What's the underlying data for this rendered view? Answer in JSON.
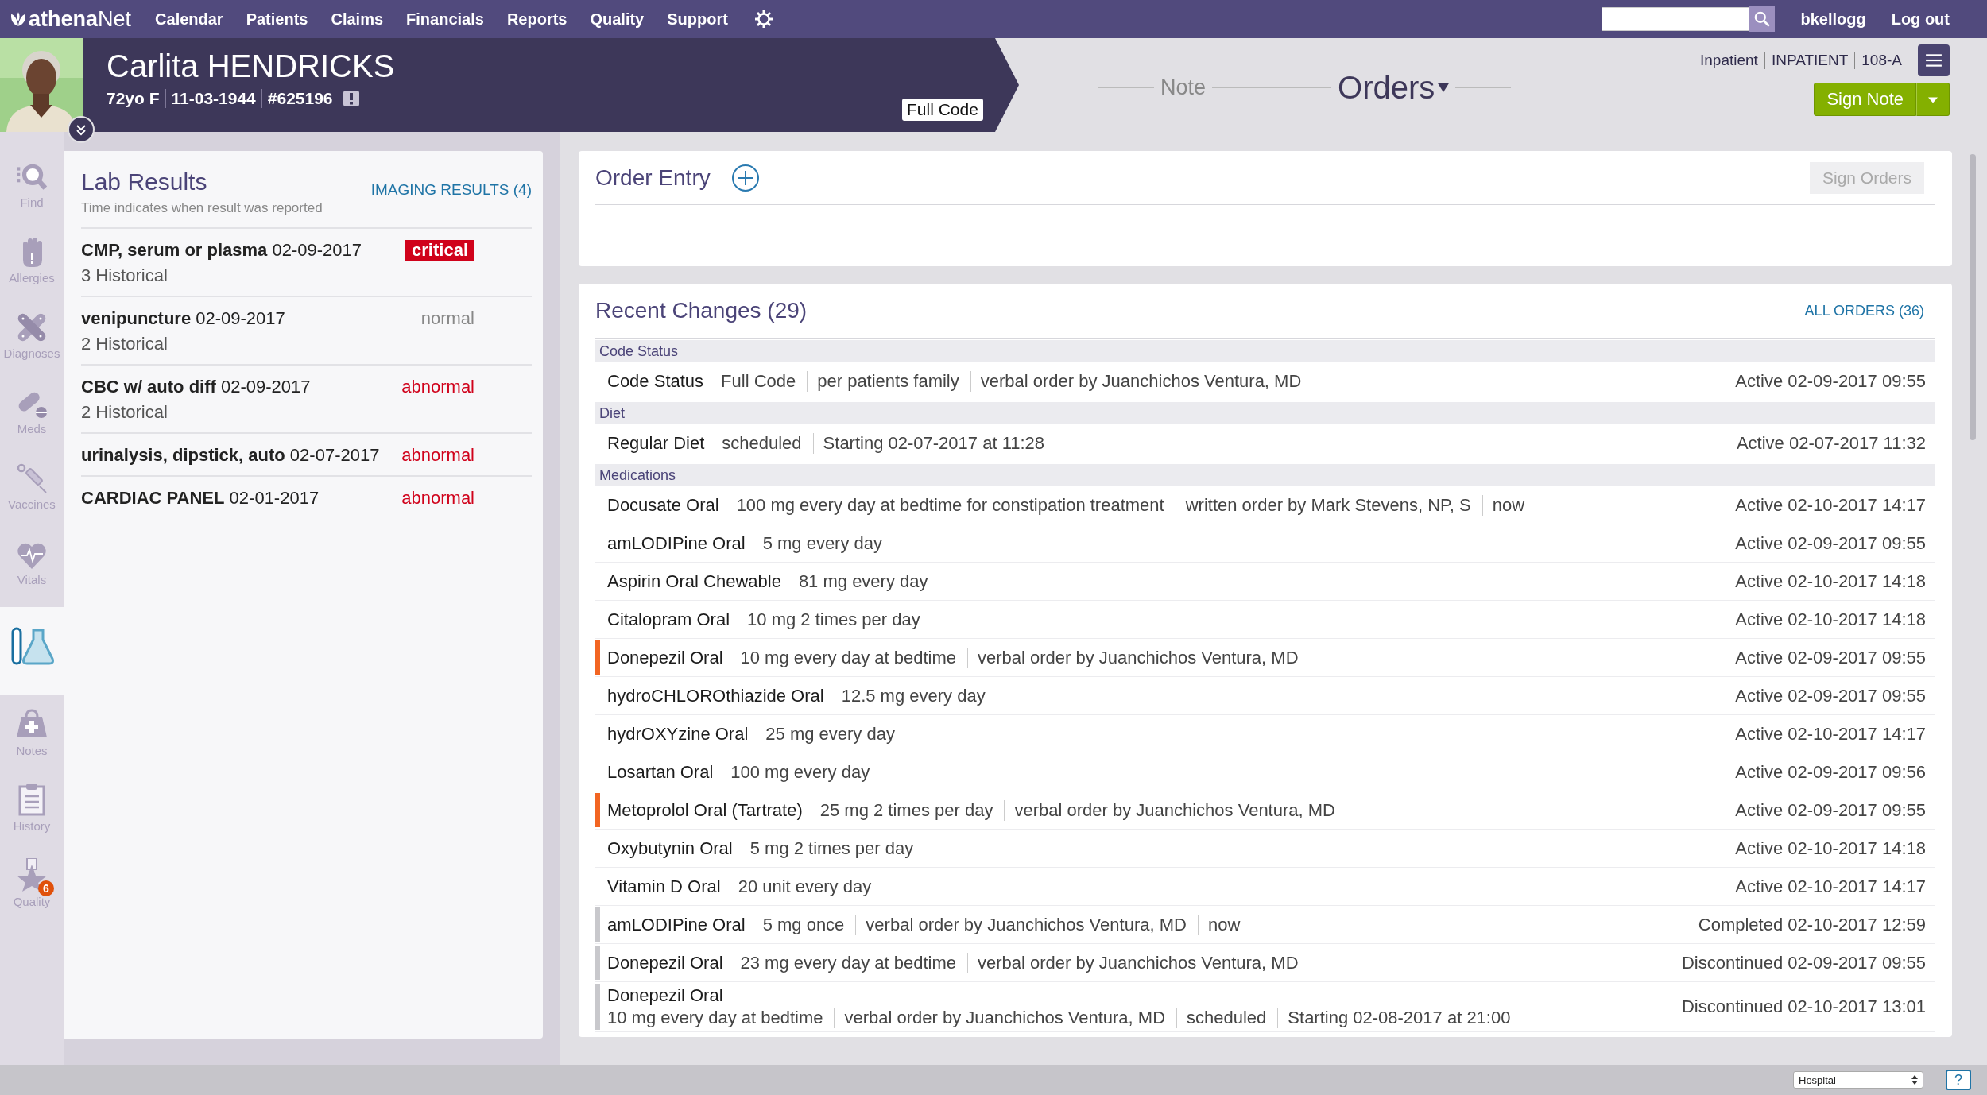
{
  "top_nav": {
    "logo": "**athena**Net",
    "items": [
      "Calendar",
      "Patients",
      "Claims",
      "Financials",
      "Reports",
      "Quality",
      "Support"
    ],
    "user": "bkellogg",
    "logout": "Log out"
  },
  "patient": {
    "name": "Carlita HENDRICKS",
    "age_sex": "72yo F",
    "dob": "11-03-1944",
    "id": "#625196",
    "code_status": "Full Code"
  },
  "encounter": [
    "Inpatient",
    "INPATIENT",
    "108-A"
  ],
  "workflow": [
    {
      "label": "Note",
      "selected": false
    },
    {
      "label": "Orders",
      "selected": true
    }
  ],
  "sign_note": "Sign Note",
  "sidebar": [
    {
      "kind": "find",
      "label": "Find",
      "selected": false
    },
    {
      "kind": "allergies",
      "label": "Allergies",
      "selected": false
    },
    {
      "kind": "diagnoses",
      "label": "Diagnoses",
      "selected": false
    },
    {
      "kind": "meds",
      "label": "Meds",
      "selected": false
    },
    {
      "kind": "vaccines",
      "label": "Vaccines",
      "selected": false
    },
    {
      "kind": "vitals",
      "label": "Vitals",
      "selected": false
    },
    {
      "kind": "labs",
      "selected": true
    },
    {
      "kind": "notes",
      "label": "Notes",
      "selected": false
    },
    {
      "kind": "history",
      "label": "History",
      "selected": false
    },
    {
      "kind": "quality",
      "label": "Quality",
      "selected": false,
      "badge": "6"
    }
  ],
  "lab_results": {
    "title": "Lab Results",
    "imaging_link": "IMAGING RESULTS (4)",
    "subtitle": "Time indicates when result was reported",
    "rows": [
      {
        "name": "CMP, serum or plasma",
        "date": "02-09-2017",
        "historical": "3 Historical",
        "status": "critical",
        "kind": "critical"
      },
      {
        "name": "venipuncture",
        "date": "02-09-2017",
        "historical": "2 Historical",
        "status": "normal",
        "kind": "normal"
      },
      {
        "name": "CBC w/ auto diff",
        "date": "02-09-2017",
        "historical": "2 Historical",
        "status": "abnormal",
        "kind": "abnormal"
      },
      {
        "name": "urinalysis, dipstick, auto",
        "date": "02-07-2017",
        "status": "abnormal",
        "kind": "abnormal"
      },
      {
        "name": "CARDIAC PANEL",
        "date": "02-01-2017",
        "status": "abnormal",
        "kind": "abnormal"
      }
    ]
  },
  "order_entry": {
    "title": "Order Entry",
    "sign_button": {
      "label": "Sign Orders",
      "disabled": true
    }
  },
  "recent_changes": {
    "title": "Recent Changes (29)",
    "all_orders": "ALL ORDERS (36)",
    "sections": [
      {
        "name": "Code Status",
        "rows": [
          {
            "name": "Code Status",
            "details": [
              "Full Code",
              "per patients family",
              "verbal order by Juanchichos Ventura, MD"
            ],
            "status": "Active 02-09-2017 09:55"
          }
        ]
      },
      {
        "name": "Diet",
        "rows": [
          {
            "name": "Regular Diet",
            "details": [
              "scheduled",
              "Starting 02-07-2017 at 11:28"
            ],
            "status": "Active 02-07-2017 11:32"
          }
        ]
      },
      {
        "name": "Medications",
        "rows": [
          {
            "name": "Docusate Oral",
            "details": [
              "100 mg every day at bedtime for constipation treatment",
              "written order by Mark Stevens, NP, S",
              "now"
            ],
            "status": "Active 02-10-2017 14:17"
          },
          {
            "name": "amLODIPine Oral",
            "details": [
              "5 mg every day"
            ],
            "status": "Active 02-09-2017 09:55"
          },
          {
            "name": "Aspirin Oral Chewable",
            "details": [
              "81 mg every day"
            ],
            "status": "Active 02-10-2017 14:18"
          },
          {
            "name": "Citalopram Oral",
            "details": [
              "10 mg 2 times per day"
            ],
            "status": "Active 02-10-2017 14:18"
          },
          {
            "name": "Donepezil Oral",
            "details": [
              "10 mg every day at bedtime",
              "verbal order by Juanchichos Ventura, MD"
            ],
            "status": "Active 02-09-2017 09:55",
            "color": "#f26522"
          },
          {
            "name": "hydroCHLOROthiazide Oral",
            "details": [
              "12.5 mg every day"
            ],
            "status": "Active 02-09-2017 09:55"
          },
          {
            "name": "hydrOXYzine Oral",
            "details": [
              "25 mg every day"
            ],
            "status": "Active 02-10-2017 14:17"
          },
          {
            "name": "Losartan Oral",
            "details": [
              "100 mg every day"
            ],
            "status": "Active 02-09-2017 09:56"
          },
          {
            "name": "Metoprolol Oral (Tartrate)",
            "details": [
              "25 mg 2 times per day",
              "verbal order by Juanchichos Ventura, MD"
            ],
            "status": "Active 02-09-2017 09:55",
            "color": "#f26522"
          },
          {
            "name": "Oxybutynin Oral",
            "details": [
              "5 mg 2 times per day"
            ],
            "status": "Active 02-10-2017 14:18"
          },
          {
            "name": "Vitamin D Oral",
            "details": [
              "20 unit every day"
            ],
            "status": "Active 02-10-2017 14:17"
          },
          {
            "name": "amLODIPine Oral",
            "details": [
              "5 mg once",
              "verbal order by Juanchichos Ventura, MD",
              "now"
            ],
            "status": "Completed 02-10-2017 12:59",
            "color": "#c8c8cc"
          },
          {
            "name": "Donepezil Oral",
            "details": [
              "23 mg every day at bedtime",
              "verbal order by Juanchichos Ventura, MD"
            ],
            "status": "Discontinued 02-09-2017 09:55",
            "color": "#c8c8cc"
          },
          {
            "name": "Donepezil Oral",
            "wrap": true,
            "details": [
              "10 mg every day at bedtime",
              "verbal order by Juanchichos Ventura, MD",
              "scheduled",
              "Starting 02-08-2017 at 21:00"
            ],
            "status": "Discontinued 02-10-2017 13:01",
            "color": "#c8c8cc"
          }
        ]
      }
    ]
  },
  "status_bar": {
    "location": "Hospital",
    "help": "?"
  }
}
